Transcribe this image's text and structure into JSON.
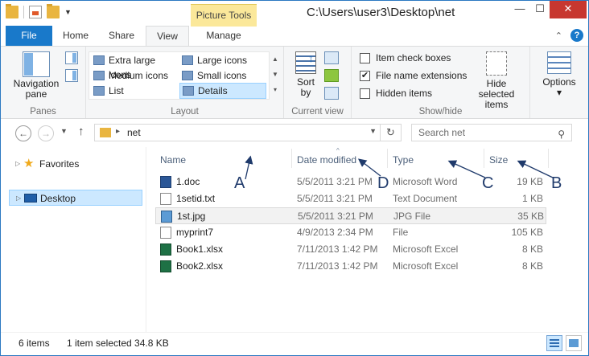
{
  "window": {
    "title": "C:\\Users\\user3\\Desktop\\net",
    "context_tab": "Picture Tools",
    "controls": {
      "minimize": "—",
      "maximize": "☐",
      "close": "✕"
    }
  },
  "ribbon_tabs": [
    "File",
    "Home",
    "Share",
    "View",
    "Manage"
  ],
  "ribbon": {
    "panes": {
      "navigation_pane": "Navigation pane",
      "group_label": "Panes"
    },
    "layout": {
      "items": [
        "Extra large icons",
        "Large icons",
        "Medium icons",
        "Small icons",
        "List",
        "Details"
      ],
      "selected": "Details",
      "group_label": "Layout"
    },
    "current_view": {
      "sort_by": "Sort by",
      "group_label": "Current view"
    },
    "show_hide": {
      "item_check_boxes": "Item check boxes",
      "file_name_extensions": "File name extensions",
      "hidden_items": "Hidden items",
      "checked": [
        "File name extensions"
      ],
      "hide_selected_items": "Hide selected items",
      "group_label": "Show/hide"
    },
    "options": {
      "label": "Options"
    }
  },
  "address": {
    "path": "net",
    "search_placeholder": "Search net"
  },
  "nav_pane": {
    "favorites": "Favorites",
    "desktop": "Desktop"
  },
  "columns": {
    "name": "Name",
    "date_modified": "Date modified",
    "type": "Type",
    "size": "Size"
  },
  "files": [
    {
      "name": "1.doc",
      "date": "5/5/2011 3:21 PM",
      "type": "Microsoft Word 9...",
      "size": "19 KB",
      "icon": "word-icon"
    },
    {
      "name": "1setid.txt",
      "date": "5/5/2011 3:21 PM",
      "type": "Text Document",
      "size": "1 KB",
      "icon": "text-file-icon"
    },
    {
      "name": "1st.jpg",
      "date": "5/5/2011 3:21 PM",
      "type": "JPG File",
      "size": "35 KB",
      "icon": "image-file-icon"
    },
    {
      "name": "myprint7",
      "date": "4/9/2013 2:34 PM",
      "type": "File",
      "size": "105 KB",
      "icon": "generic-file-icon"
    },
    {
      "name": "Book1.xlsx",
      "date": "7/11/2013 1:42 PM",
      "type": "Microsoft Excel W...",
      "size": "8 KB",
      "icon": "excel-icon"
    },
    {
      "name": "Book2.xlsx",
      "date": "7/11/2013 1:42 PM",
      "type": "Microsoft Excel W...",
      "size": "8 KB",
      "icon": "excel-icon"
    }
  ],
  "selected_file": "1st.jpg",
  "annotations": [
    "A",
    "D",
    "C",
    "B"
  ],
  "status": {
    "items": "6 items",
    "selection": "1 item selected  34.8 KB"
  },
  "colors": {
    "accent": "#1979ca",
    "selection": "#cce8ff",
    "annotation": "#1f3a6b"
  }
}
